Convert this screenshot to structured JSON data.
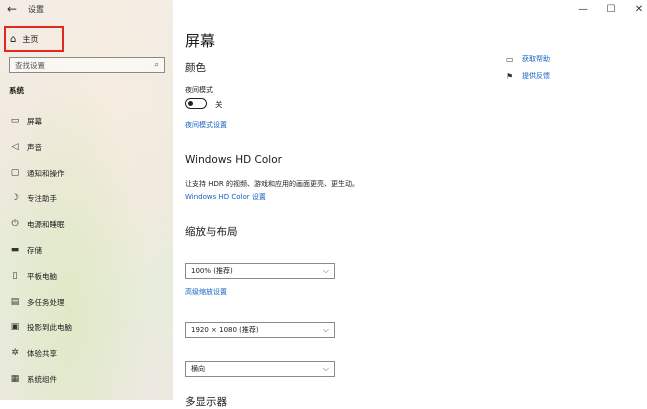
{
  "window": {
    "title": "设置",
    "controls": [
      "—",
      "☐",
      "✕"
    ]
  },
  "sidebar": {
    "home_label": "主页",
    "search_placeholder": "查找设置",
    "section": "系统",
    "items": [
      {
        "icon": "monitor-icon",
        "glyph": "▭",
        "label": "屏幕"
      },
      {
        "icon": "speaker-icon",
        "glyph": "◁",
        "label": "声音"
      },
      {
        "icon": "notification-icon",
        "glyph": "▢",
        "label": "通知和操作"
      },
      {
        "icon": "moon-icon",
        "glyph": "☽",
        "label": "专注助手"
      },
      {
        "icon": "power-icon",
        "glyph": "⏻",
        "label": "电源和睡眠"
      },
      {
        "icon": "storage-icon",
        "glyph": "▬",
        "label": "存储"
      },
      {
        "icon": "tablet-icon",
        "glyph": "▯",
        "label": "平板电脑"
      },
      {
        "icon": "multitask-icon",
        "glyph": "▤",
        "label": "多任务处理"
      },
      {
        "icon": "project-icon",
        "glyph": "▣",
        "label": "投影到此电脑"
      },
      {
        "icon": "share-icon",
        "glyph": "✲",
        "label": "体验共享"
      },
      {
        "icon": "components-icon",
        "glyph": "▦",
        "label": "系统组件"
      }
    ]
  },
  "main": {
    "title": "屏幕",
    "color": {
      "heading": "颜色",
      "night_mode_label": "夜间模式",
      "toggle_state": "关",
      "night_mode_link": "夜间模式设置"
    },
    "hdr": {
      "heading": "Windows HD Color",
      "description": "让支持 HDR 的视频、游戏和应用的画面更亮、更生动。",
      "link": "Windows HD Color 设置"
    },
    "scale": {
      "heading": "缩放与布局",
      "scale_value": "100% (推荐)",
      "advanced_link": "高级缩放设置",
      "resolution_value": "1920 × 1080 (推荐)",
      "orientation_value": "横向"
    },
    "next_heading": "多显示器",
    "help": {
      "get_help": "获取帮助",
      "feedback": "提供反馈"
    }
  }
}
